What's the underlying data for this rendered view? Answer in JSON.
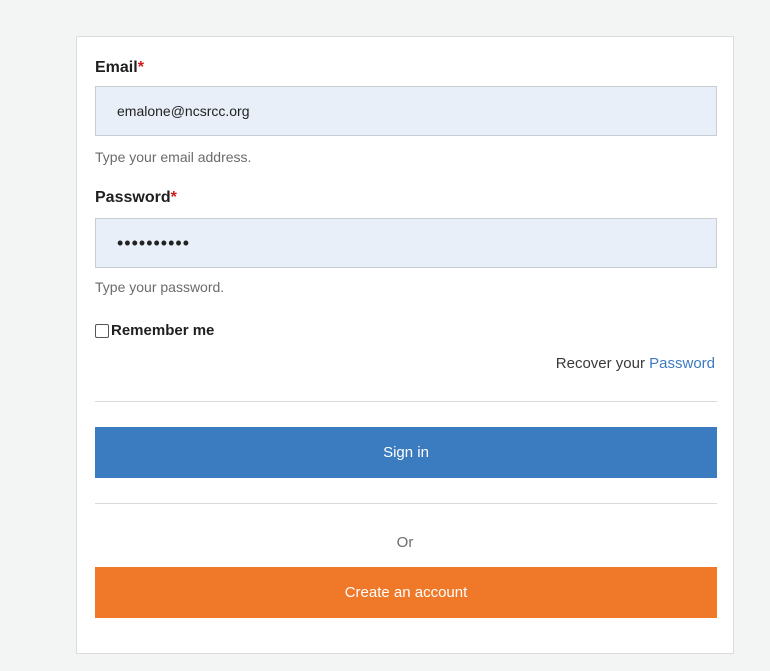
{
  "form": {
    "email": {
      "label": "Email",
      "required_mark": "*",
      "value": "emalone@ncsrcc.org",
      "help": "Type your email address."
    },
    "password": {
      "label": "Password",
      "required_mark": "*",
      "value": "••••••••••",
      "help": "Type your password."
    },
    "remember_me": {
      "label": "Remember me",
      "checked": false
    },
    "recover": {
      "prefix": "Recover your ",
      "link_text": "Password"
    },
    "sign_in_label": "Sign in",
    "or_text": "Or",
    "create_account_label": "Create an account"
  },
  "colors": {
    "background": "#f3f4f4",
    "input_fill": "#e8eff8",
    "required": "#d11a1a",
    "link": "#3d7bbf",
    "primary_button": "#3b7bbf",
    "secondary_button": "#f07829"
  }
}
